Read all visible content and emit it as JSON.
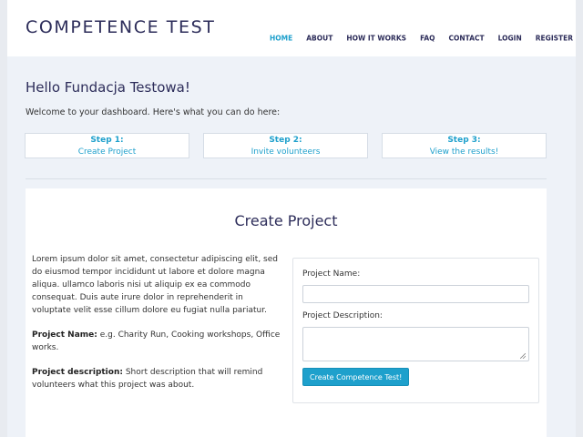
{
  "header": {
    "brand": "COMPETENCE TEST",
    "nav": [
      {
        "label": "HOME",
        "active": true
      },
      {
        "label": "ABOUT",
        "active": false
      },
      {
        "label": "HOW IT WORKS",
        "active": false
      },
      {
        "label": "FAQ",
        "active": false
      },
      {
        "label": "CONTACT",
        "active": false
      },
      {
        "label": "LOGIN",
        "active": false
      },
      {
        "label": "REGISTER",
        "active": false
      }
    ]
  },
  "dashboard": {
    "greeting": "Hello Fundacja Testowa!",
    "welcome": "Welcome to your dashboard. Here's what you can do here:",
    "steps": [
      {
        "title": "Step 1:",
        "link": "Create Project"
      },
      {
        "title": "Step 2:",
        "link": "Invite volunteers"
      },
      {
        "title": "Step 3:",
        "link": "View the results!"
      }
    ]
  },
  "create_project": {
    "title": "Create Project",
    "intro": "Lorem ipsum dolor sit amet, consectetur adipiscing elit, sed do eiusmod tempor incididunt ut labore et dolore magna aliqua. ullamco laboris nisi ut aliquip ex ea commodo consequat. Duis aute irure dolor in reprehenderit in voluptate velit esse cillum dolore eu fugiat nulla pariatur.",
    "name_help_label": "Project Name:",
    "name_help_text": " e.g. Charity Run, Cooking workshops, Office works.",
    "desc_help_label": "Project description:",
    "desc_help_text": " Short description that will remind volunteers what this project was about.",
    "form": {
      "name_label": "Project Name:",
      "name_value": "",
      "desc_label": "Project Description:",
      "desc_value": "",
      "submit_label": "Create Competence Test!"
    }
  },
  "colors": {
    "accent": "#1ea0cc",
    "heading": "#2d2d5a",
    "background": "#eef2f8"
  }
}
